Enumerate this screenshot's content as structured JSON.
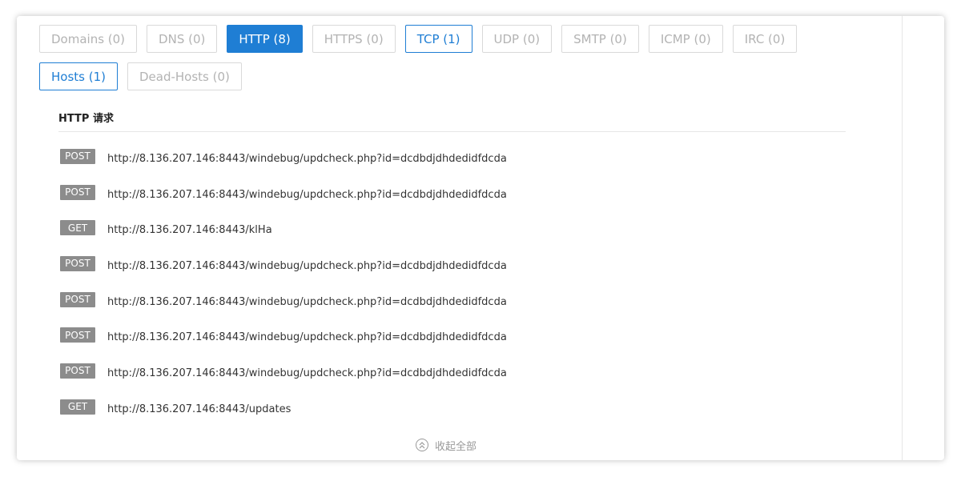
{
  "tabs_row1": [
    {
      "label": "Domains (0)",
      "state": "default"
    },
    {
      "label": "DNS (0)",
      "state": "default"
    },
    {
      "label": "HTTP (8)",
      "state": "active"
    },
    {
      "label": "HTTPS (0)",
      "state": "default"
    },
    {
      "label": "TCP (1)",
      "state": "outlined"
    },
    {
      "label": "UDP (0)",
      "state": "default"
    },
    {
      "label": "SMTP (0)",
      "state": "default"
    },
    {
      "label": "ICMP (0)",
      "state": "default"
    },
    {
      "label": "IRC (0)",
      "state": "default"
    }
  ],
  "tabs_row2": [
    {
      "label": "Hosts (1)",
      "state": "outlined"
    },
    {
      "label": "Dead-Hosts (0)",
      "state": "default"
    }
  ],
  "section": {
    "title": "HTTP 请求"
  },
  "requests": [
    {
      "method": "POST",
      "url": "http://8.136.207.146:8443/windebug/updcheck.php?id=dcdbdjdhdedidfdcda"
    },
    {
      "method": "POST",
      "url": "http://8.136.207.146:8443/windebug/updcheck.php?id=dcdbdjdhdedidfdcda"
    },
    {
      "method": "GET",
      "url": "http://8.136.207.146:8443/klHa"
    },
    {
      "method": "POST",
      "url": "http://8.136.207.146:8443/windebug/updcheck.php?id=dcdbdjdhdedidfdcda"
    },
    {
      "method": "POST",
      "url": "http://8.136.207.146:8443/windebug/updcheck.php?id=dcdbdjdhdedidfdcda"
    },
    {
      "method": "POST",
      "url": "http://8.136.207.146:8443/windebug/updcheck.php?id=dcdbdjdhdedidfdcda"
    },
    {
      "method": "POST",
      "url": "http://8.136.207.146:8443/windebug/updcheck.php?id=dcdbdjdhdedidfdcda"
    },
    {
      "method": "GET",
      "url": "http://8.136.207.146:8443/updates"
    }
  ],
  "collapse": {
    "label": "收起全部",
    "icon": "chevron-double-up-icon"
  },
  "colors": {
    "accent": "#1f7ed4",
    "badge": "#8c8c8c"
  }
}
